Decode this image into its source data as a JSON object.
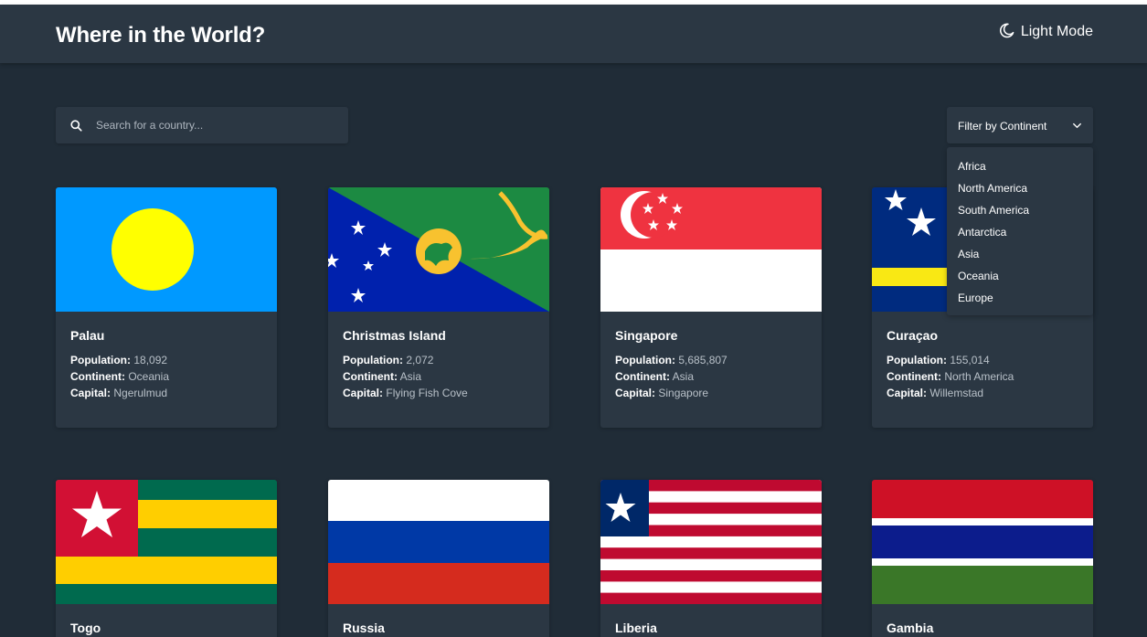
{
  "header": {
    "title": "Where in the World?",
    "theme_toggle_label": "Light Mode"
  },
  "search": {
    "placeholder": "Search for a country..."
  },
  "filter": {
    "label": "Filter by Continent",
    "options": [
      "Africa",
      "North America",
      "South America",
      "Antarctica",
      "Asia",
      "Oceania",
      "Europe"
    ]
  },
  "labels": {
    "population": "Population:",
    "continent": "Continent:",
    "capital": "Capital:"
  },
  "countries": [
    {
      "name": "Palau",
      "population": "18,092",
      "continent": "Oceania",
      "capital": "Ngerulmud"
    },
    {
      "name": "Christmas Island",
      "population": "2,072",
      "continent": "Asia",
      "capital": "Flying Fish Cove"
    },
    {
      "name": "Singapore",
      "population": "5,685,807",
      "continent": "Asia",
      "capital": "Singapore"
    },
    {
      "name": "Curaçao",
      "population": "155,014",
      "continent": "North America",
      "capital": "Willemstad"
    },
    {
      "name": "Togo"
    },
    {
      "name": "Russia"
    },
    {
      "name": "Liberia"
    },
    {
      "name": "Gambia"
    }
  ],
  "colors": {
    "background": "#202c37",
    "surface": "#2b3743",
    "text": "#ffffff",
    "muted": "#b8c0c8"
  }
}
